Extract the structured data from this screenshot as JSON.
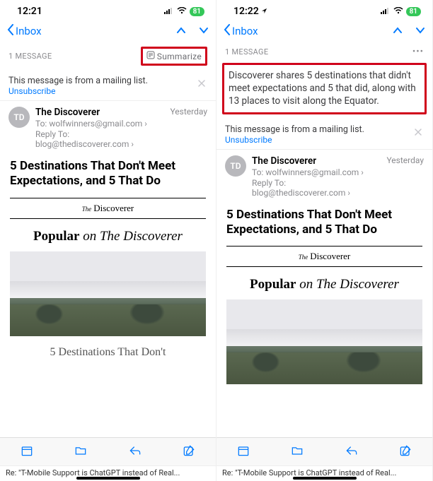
{
  "left": {
    "status": {
      "time": "12:21",
      "battery": "81"
    },
    "nav": {
      "back_label": "Inbox"
    },
    "header": {
      "count_label": "1 MESSAGE",
      "summarize_label": "Summarize"
    },
    "mailing": {
      "text": "This message is from a mailing list.",
      "unsubscribe": "Unsubscribe"
    },
    "sender": {
      "initials": "TD",
      "name": "The Discoverer",
      "to_label": "To:",
      "to_addr": "wolfwinners@gmail.com",
      "reply_label": "Reply To:",
      "reply_addr": "blog@thediscoverer.com",
      "timestamp": "Yesterday"
    },
    "subject": "5 Destinations That Don't Meet Expectations, and 5 That Do",
    "body": {
      "brand_the": "The",
      "brand_name": "Discoverer",
      "popular_bold": "Popular",
      "popular_on": " on ",
      "popular_ital": "The Discoverer",
      "article_tease": "5 Destinations That Don't"
    },
    "tab": "Re: \"T-Mobile Support is ChatGPT instead of Real..."
  },
  "right": {
    "status": {
      "time": "12:22",
      "battery": "81"
    },
    "nav": {
      "back_label": "Inbox"
    },
    "header": {
      "count_label": "1 MESSAGE"
    },
    "summary": "Discoverer shares 5 destinations that didn't meet expectations and 5 that did, along with 13 places to visit along the Equator.",
    "mailing": {
      "text": "This message is from a mailing list.",
      "unsubscribe": "Unsubscribe"
    },
    "sender": {
      "initials": "TD",
      "name": "The Discoverer",
      "to_label": "To:",
      "to_addr": "wolfwinners@gmail.com",
      "reply_label": "Reply To:",
      "reply_addr": "blog@thediscoverer.com",
      "timestamp": "Yesterday"
    },
    "subject": "5 Destinations That Don't Meet Expectations, and 5 That Do",
    "body": {
      "brand_the": "The",
      "brand_name": "Discoverer",
      "popular_bold": "Popular",
      "popular_on": " on ",
      "popular_ital": "The Discoverer"
    },
    "tab": "Re: \"T-Mobile Support is ChatGPT instead of Real..."
  }
}
